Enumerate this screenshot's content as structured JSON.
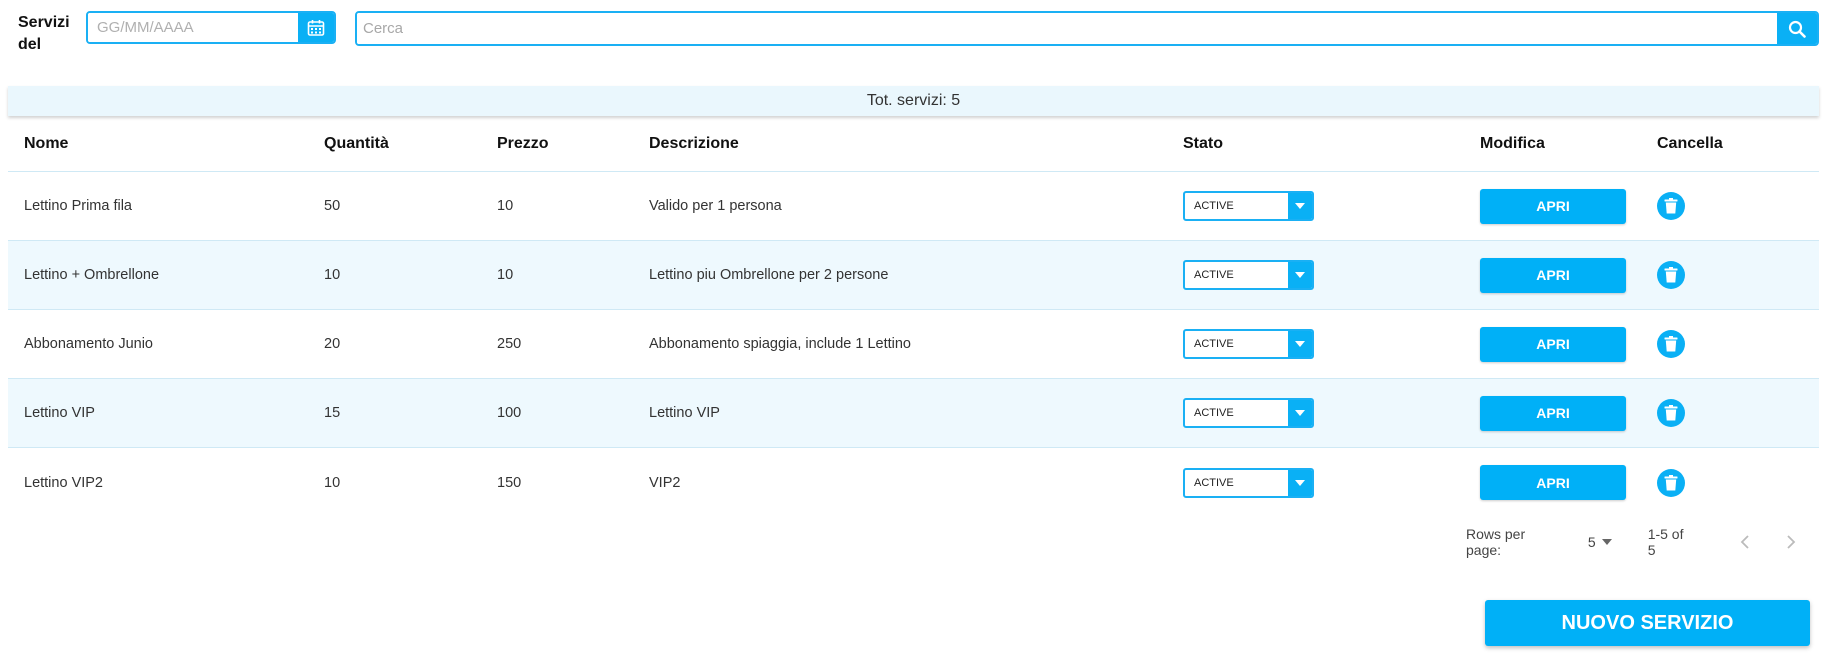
{
  "header": {
    "servizi_label": "Servizi del",
    "date_placeholder": "GG/MM/AAAA",
    "search_placeholder": "Cerca"
  },
  "table": {
    "total_label": "Tot. servizi: 5",
    "columns": {
      "nome": "Nome",
      "quantita": "Quantità",
      "prezzo": "Prezzo",
      "descrizione": "Descrizione",
      "stato": "Stato",
      "modifica": "Modifica",
      "cancella": "Cancella"
    },
    "rows": [
      {
        "nome": "Lettino Prima fila",
        "quantita": "50",
        "prezzo": "10",
        "descrizione": "Valido per 1 persona",
        "stato": "ACTIVE",
        "modifica": "APRI"
      },
      {
        "nome": "Lettino + Ombrellone",
        "quantita": "10",
        "prezzo": "10",
        "descrizione": "Lettino piu Ombrellone per 2 persone",
        "stato": "ACTIVE",
        "modifica": "APRI"
      },
      {
        "nome": "Abbonamento Junio",
        "quantita": "20",
        "prezzo": "250",
        "descrizione": "Abbonamento spiaggia, include 1 Lettino",
        "stato": "ACTIVE",
        "modifica": "APRI"
      },
      {
        "nome": "Lettino VIP",
        "quantita": "15",
        "prezzo": "100",
        "descrizione": "Lettino VIP",
        "stato": "ACTIVE",
        "modifica": "APRI"
      },
      {
        "nome": "Lettino VIP2",
        "quantita": "10",
        "prezzo": "150",
        "descrizione": "VIP2",
        "stato": "ACTIVE",
        "modifica": "APRI"
      }
    ]
  },
  "pagination": {
    "rows_per_page_label": "Rows per page:",
    "rows_per_page_value": "5",
    "range": "1-5 of 5"
  },
  "actions": {
    "nuovo_servizio": "NUOVO SERVIZIO"
  },
  "icons": {
    "calendar": "calendar-icon",
    "search": "search-icon",
    "dropdown": "caret-down-icon",
    "trash": "trash-icon",
    "prev": "chevron-left-icon",
    "next": "chevron-right-icon"
  },
  "colors": {
    "accent": "#0ab0f5",
    "row_alt": "#eef9fe",
    "total_bar": "#eaf7fd"
  }
}
